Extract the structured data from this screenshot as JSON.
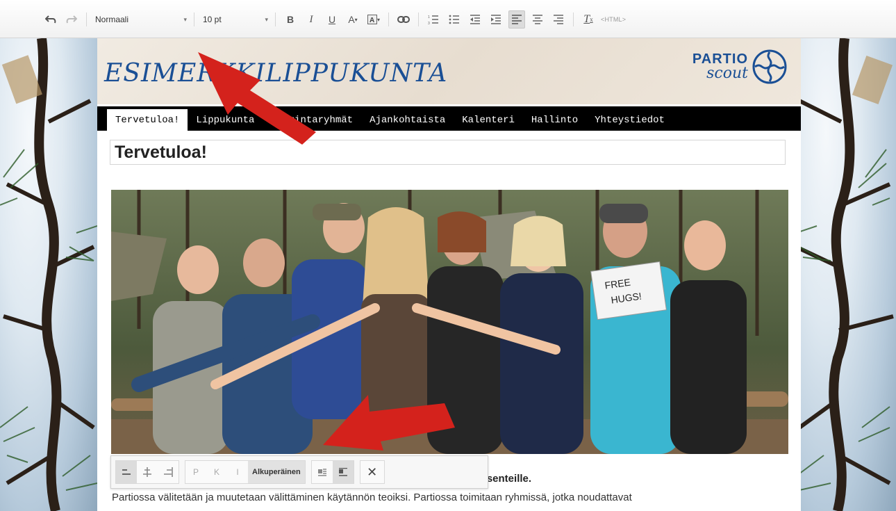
{
  "toolbar": {
    "format_value": "Normaali",
    "size_value": "10 pt",
    "html_label": "<HTML>"
  },
  "site": {
    "title": "ESIMERKKILIPPUKUNTA",
    "logo_line1": "PARTIO",
    "logo_line2": "scout"
  },
  "nav": {
    "items": [
      "Tervetuloa!",
      "Lippukunta",
      "Toimintaryhmät",
      "Ajankohtaista",
      "Kalenteri",
      "Hallinto",
      "Yhteystiedot"
    ]
  },
  "page": {
    "heading": "Tervetuloa!",
    "bold_tail": "”-asenteille.",
    "body_text": "Partiossa välitetään ja muutetaan välittäminen käytännön teoiksi. Partiossa toimitaan ryhmissä, jotka noudattavat",
    "photo_sign": [
      "FREE",
      "HUGS!"
    ]
  },
  "image_toolbar": {
    "size_p": "P",
    "size_k": "K",
    "size_i": "I",
    "original_label": "Alkuperäinen"
  },
  "colors": {
    "brand_blue": "#1a4f95",
    "arrow_red": "#d4221c"
  }
}
